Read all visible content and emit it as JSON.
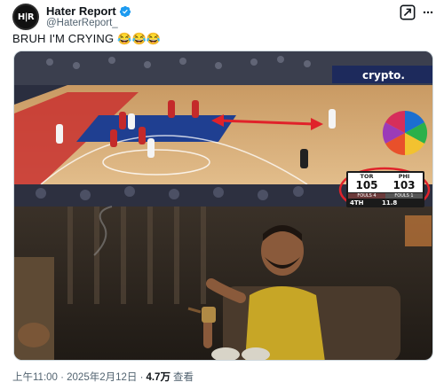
{
  "account": {
    "avatar_text": "H|R",
    "display_name": "Hater Report",
    "handle": "@HaterReport_",
    "verified": true
  },
  "tweet": {
    "text": "BRUH I'M CRYING 😂😂😂"
  },
  "media": {
    "court_ad_text": "crypto.",
    "scoreboard": {
      "home_abbr": "TOR",
      "home_score": "105",
      "home_fouls": "FOULS 4",
      "away_abbr": "PHI",
      "away_score": "103",
      "away_fouls": "FOULS 1",
      "period": "4TH",
      "clock": "11.8"
    }
  },
  "meta": {
    "timestamp": "上午11:00 · 2025年2月12日 ·",
    "views": "4.7万",
    "views_label": "查看"
  },
  "colors": {
    "accent_blue": "#1d9bf0",
    "court_wood": "#d9b07a",
    "court_blue": "#1f3f91",
    "highlight_red": "#e0222a"
  }
}
